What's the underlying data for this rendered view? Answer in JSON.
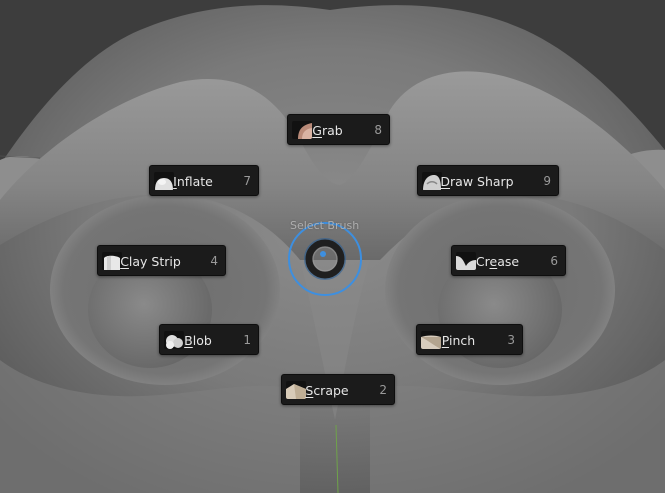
{
  "pie_menu": {
    "title": "Select Brush",
    "accent_color": "#3d8fe0",
    "items": [
      {
        "label_pre": "",
        "label_acc": "G",
        "label_post": "rab",
        "hotkey": "8",
        "icon": "grab-brush-icon"
      },
      {
        "label_pre": "",
        "label_acc": "I",
        "label_post": "nflate",
        "hotkey": "7",
        "icon": "inflate-brush-icon"
      },
      {
        "label_pre": "",
        "label_acc": "D",
        "label_post": "raw Sharp",
        "hotkey": "9",
        "icon": "draw-sharp-brush-icon"
      },
      {
        "label_pre": "",
        "label_acc": "C",
        "label_post": "lay Strip",
        "hotkey": "4",
        "icon": "clay-strip-brush-icon"
      },
      {
        "label_pre": "Cr",
        "label_acc": "e",
        "label_post": "ase",
        "hotkey": "6",
        "icon": "crease-brush-icon"
      },
      {
        "label_pre": "",
        "label_acc": "B",
        "label_post": "lob",
        "hotkey": "1",
        "icon": "blob-brush-icon"
      },
      {
        "label_pre": "",
        "label_acc": "P",
        "label_post": "inch",
        "hotkey": "3",
        "icon": "pinch-brush-icon"
      },
      {
        "label_pre": "",
        "label_acc": "S",
        "label_post": "crape",
        "hotkey": "2",
        "icon": "scrape-brush-icon"
      }
    ]
  }
}
